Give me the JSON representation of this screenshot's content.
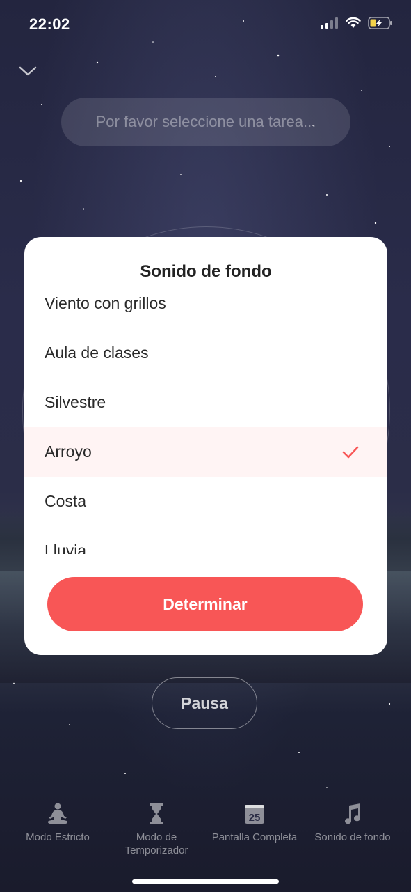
{
  "status_bar": {
    "time": "22:02"
  },
  "task_selector": {
    "placeholder": "Por favor seleccione una tarea..."
  },
  "modal": {
    "title": "Sonido de fondo",
    "items": [
      {
        "label": "Viento con grillos",
        "selected": false
      },
      {
        "label": "Aula de clases",
        "selected": false
      },
      {
        "label": "Silvestre",
        "selected": false
      },
      {
        "label": "Arroyo",
        "selected": true
      },
      {
        "label": "Costa",
        "selected": false
      },
      {
        "label": "Lluvia",
        "selected": false
      }
    ],
    "confirm_label": "Determinar"
  },
  "pause_label": "Pausa",
  "tabbar": {
    "strict": "Modo Estricto",
    "timer": "Modo de Temporizador",
    "fullscreen": "Pantalla Completa",
    "fullscreen_icon_text": "25",
    "sound": "Sonido de fondo"
  },
  "colors": {
    "accent": "#f85656",
    "selected_row": "#fff4f4"
  }
}
